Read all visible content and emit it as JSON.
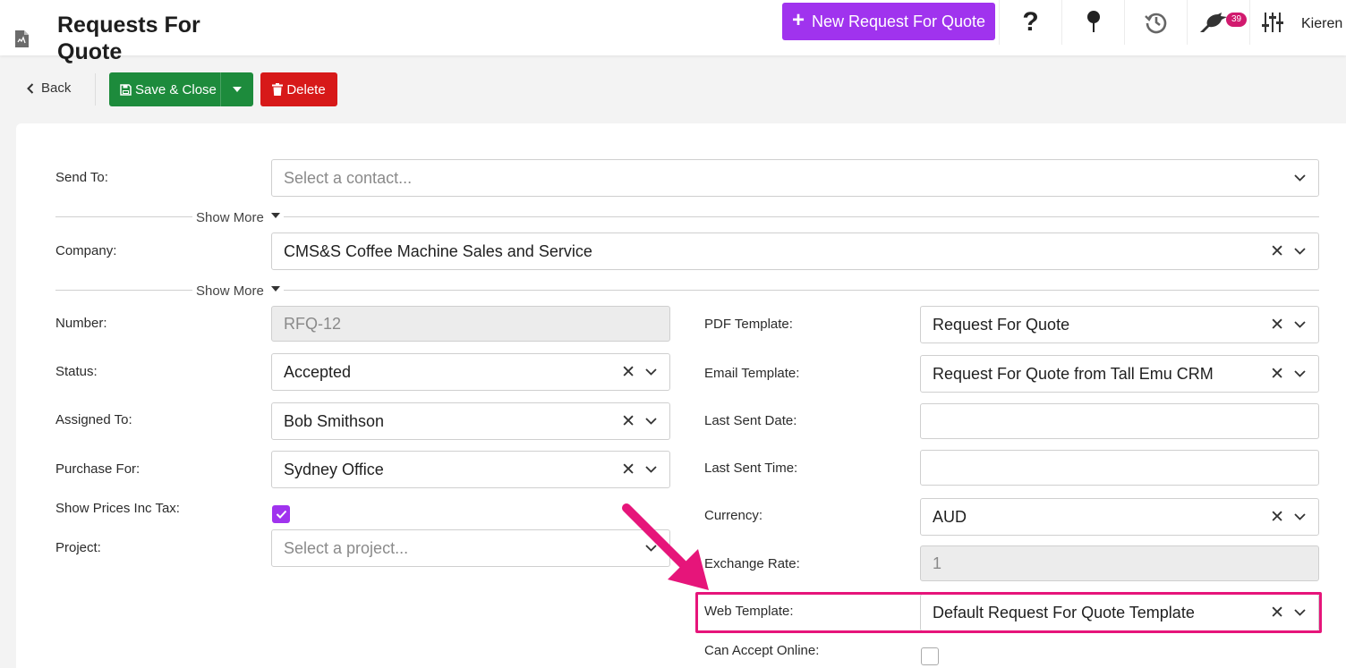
{
  "header": {
    "page_title": "Requests For Quote",
    "new_button_label": "New Request For Quote",
    "help_icon": "?",
    "notification_count": "39",
    "user_name": "Kieren"
  },
  "toolbar": {
    "back_label": "Back",
    "save_label": "Save & Close",
    "delete_label": "Delete"
  },
  "form": {
    "send_to": {
      "label": "Send To:",
      "placeholder": "Select a contact..."
    },
    "show_more_1": "Show More",
    "company": {
      "label": "Company:",
      "value": "CMS&S Coffee Machine Sales and Service"
    },
    "show_more_2": "Show More",
    "number": {
      "label": "Number:",
      "value": "RFQ-12"
    },
    "status": {
      "label": "Status:",
      "value": "Accepted"
    },
    "assigned_to": {
      "label": "Assigned To:",
      "value": "Bob Smithson"
    },
    "purchase_for": {
      "label": "Purchase For:",
      "value": "Sydney Office"
    },
    "show_prices_inc_tax": {
      "label": "Show Prices Inc Tax:",
      "checked": true
    },
    "project": {
      "label": "Project:",
      "placeholder": "Select a project..."
    },
    "pdf_template": {
      "label": "PDF Template:",
      "value": "Request For Quote"
    },
    "email_template": {
      "label": "Email Template:",
      "value": "Request For Quote from Tall Emu CRM"
    },
    "last_sent_date": {
      "label": "Last Sent Date:",
      "value": ""
    },
    "last_sent_time": {
      "label": "Last Sent Time:",
      "value": ""
    },
    "currency": {
      "label": "Currency:",
      "value": "AUD"
    },
    "exchange_rate": {
      "label": "Exchange Rate:",
      "value": "1"
    },
    "web_template": {
      "label": "Web Template:",
      "value": "Default Request For Quote Template"
    },
    "can_accept_online": {
      "label": "Can Accept Online:",
      "checked": false
    }
  },
  "colors": {
    "primary": "#a033ee",
    "save": "#1d8b3c",
    "delete": "#d71919",
    "annotation": "#e6157a"
  }
}
